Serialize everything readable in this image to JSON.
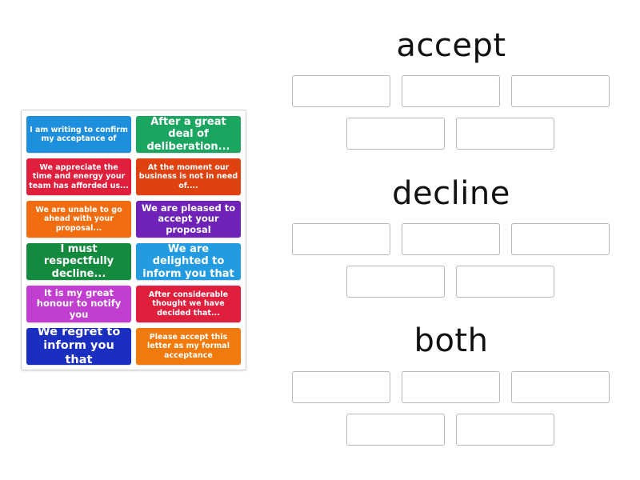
{
  "activity": {
    "type": "group-sort",
    "tiles": [
      {
        "text": "I am writing to confirm my acceptance of",
        "color": "#1e8fdc"
      },
      {
        "text": "After a great deal of deliberation...",
        "color": "#1aa560"
      },
      {
        "text": "We appreciate the time and energy your team has afforded us...",
        "color": "#e01f3d"
      },
      {
        "text": "At the moment our business is not in need of....",
        "color": "#e0420f"
      },
      {
        "text": "We are unable to go ahead with your proposal...",
        "color": "#f26d0f"
      },
      {
        "text": "We are pleased to accept your proposal",
        "color": "#6e22b8"
      },
      {
        "text": "I must respectfully decline...",
        "color": "#138a3e"
      },
      {
        "text": "We are delighted to inform you that",
        "color": "#229be0"
      },
      {
        "text": "It is my great honour to notify you",
        "color": "#c23ed0"
      },
      {
        "text": "After considerable thought we have decided that...",
        "color": "#e01f3d"
      },
      {
        "text": "We regret to inform you that",
        "color": "#1a2fbf"
      },
      {
        "text": "Please accept this letter as my formal acceptance",
        "color": "#f27a0c"
      }
    ],
    "groups": [
      {
        "title": "accept",
        "slots": 5
      },
      {
        "title": "decline",
        "slots": 5
      },
      {
        "title": "both",
        "slots": 5
      }
    ]
  }
}
